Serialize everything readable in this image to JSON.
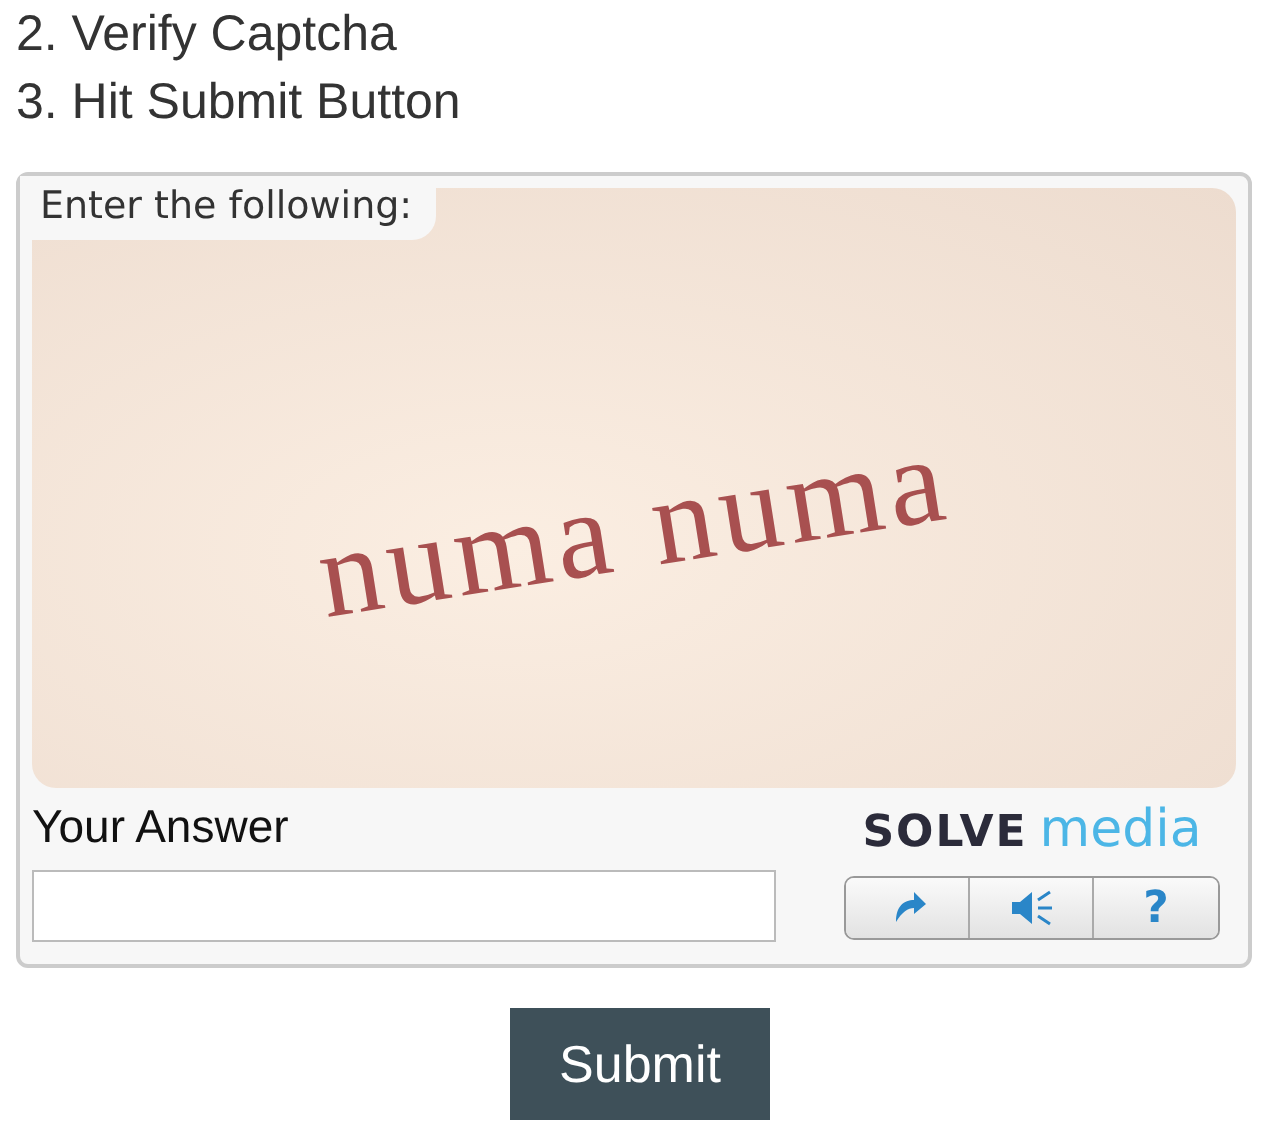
{
  "steps": [
    "2. Verify Captcha",
    "3. Hit Submit Button"
  ],
  "captcha": {
    "prompt": "Enter the following:",
    "challenge": "numa numa",
    "answer_label": "Your Answer",
    "logo": [
      "SOLVE",
      "media"
    ],
    "buttons": [
      {
        "kind": "reload"
      },
      {
        "kind": "audio"
      },
      {
        "kind": "help",
        "label": "?"
      }
    ]
  },
  "submit": "Submit"
}
